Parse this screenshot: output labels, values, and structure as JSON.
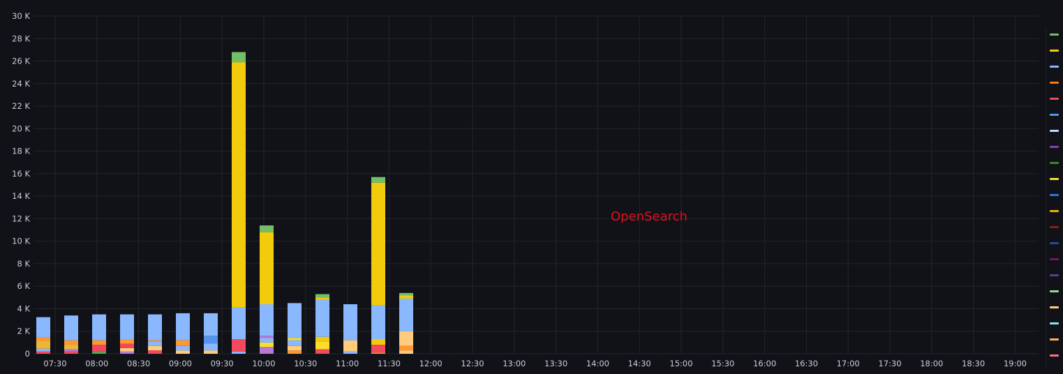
{
  "watermark": "OpenSearch",
  "chart_data": {
    "type": "bar",
    "stacked": true,
    "ylim": [
      0,
      30000
    ],
    "yticks": [
      0,
      2000,
      4000,
      6000,
      8000,
      10000,
      12000,
      14000,
      16000,
      18000,
      20000,
      22000,
      24000,
      26000,
      28000,
      30000
    ],
    "ytick_labels": [
      "0",
      "2 K",
      "4 K",
      "6 K",
      "8 K",
      "10 K",
      "12 K",
      "14 K",
      "16 K",
      "18 K",
      "20 K",
      "22 K",
      "24 K",
      "26 K",
      "28 K",
      "30 K"
    ],
    "xtick_labels": [
      "07:30",
      "08:00",
      "08:30",
      "09:00",
      "09:30",
      "10:00",
      "10:30",
      "11:00",
      "11:30",
      "12:00",
      "12:30",
      "13:00",
      "13:30",
      "14:00",
      "14:30",
      "15:00",
      "15:30",
      "16:00",
      "16:30",
      "17:00",
      "17:30",
      "18:00",
      "18:30",
      "19:00"
    ],
    "categories": [
      "07:20",
      "07:35",
      "07:50",
      "08:05",
      "08:20",
      "08:35",
      "08:50",
      "09:05",
      "09:20",
      "09:35",
      "09:50",
      "10:05",
      "10:20",
      "10:35",
      "10:50",
      "11:05",
      "11:20",
      "11:35",
      "11:50",
      "12:05",
      "12:20",
      "12:35",
      "12:50",
      "13:05"
    ],
    "segment_colors": [
      "#f2495c",
      "#b877d9",
      "#ff9830",
      "#5794f2",
      "#fade2a",
      "#ffcb7d",
      "#8ab8ff",
      "#eab839",
      "#f2cc0c",
      "#56a64b",
      "#73bf69"
    ],
    "segments": [
      [
        [
          0,
          200
        ],
        [
          6,
          250
        ],
        [
          7,
          700
        ],
        [
          2,
          300
        ],
        [
          6,
          1800
        ]
      ],
      [
        [
          0,
          200
        ],
        [
          1,
          200
        ],
        [
          7,
          400
        ],
        [
          2,
          400
        ],
        [
          6,
          2200
        ]
      ],
      [
        [
          9,
          200
        ],
        [
          0,
          600
        ],
        [
          2,
          400
        ],
        [
          6,
          2300
        ]
      ],
      [
        [
          1,
          200
        ],
        [
          5,
          300
        ],
        [
          0,
          400
        ],
        [
          2,
          400
        ],
        [
          6,
          2200
        ]
      ],
      [
        [
          0,
          300
        ],
        [
          5,
          400
        ],
        [
          6,
          400
        ],
        [
          2,
          100
        ],
        [
          6,
          2300
        ]
      ],
      [
        [
          5,
          300
        ],
        [
          6,
          400
        ],
        [
          2,
          500
        ],
        [
          6,
          2400
        ]
      ],
      [
        [
          5,
          300
        ],
        [
          6,
          600
        ],
        [
          3,
          700
        ],
        [
          6,
          2000
        ]
      ],
      [
        [
          6,
          200
        ],
        [
          0,
          1100
        ],
        [
          6,
          2800
        ],
        [
          8,
          21800
        ],
        [
          10,
          900
        ]
      ],
      [
        [
          1,
          600
        ],
        [
          4,
          400
        ],
        [
          6,
          400
        ],
        [
          1,
          200
        ],
        [
          6,
          2800
        ],
        [
          8,
          6400
        ],
        [
          10,
          600
        ]
      ],
      [
        [
          2,
          300
        ],
        [
          5,
          400
        ],
        [
          6,
          500
        ],
        [
          4,
          200
        ],
        [
          6,
          3100
        ]
      ],
      [
        [
          0,
          400
        ],
        [
          4,
          700
        ],
        [
          8,
          400
        ],
        [
          6,
          3300
        ],
        [
          8,
          200
        ],
        [
          10,
          300
        ]
      ],
      [
        [
          6,
          200
        ],
        [
          5,
          1000
        ],
        [
          6,
          3200
        ]
      ],
      [
        [
          2,
          100
        ],
        [
          0,
          700
        ],
        [
          8,
          500
        ],
        [
          6,
          3000
        ],
        [
          8,
          10900
        ],
        [
          10,
          500
        ]
      ],
      [
        [
          5,
          300
        ],
        [
          2,
          400
        ],
        [
          5,
          1300
        ],
        [
          6,
          2900
        ],
        [
          8,
          300
        ],
        [
          10,
          200
        ]
      ],
      [],
      [],
      [],
      [],
      [],
      [],
      [],
      [],
      [],
      []
    ],
    "legend_colors": [
      "#73bf69",
      "#f2cc0c",
      "#8ab8ff",
      "#ff780a",
      "#f2495c",
      "#5794f2",
      "#c0d8ff",
      "#8f3bb8",
      "#37872d",
      "#fade2a",
      "#3274d9",
      "#e0b400",
      "#8e1d17",
      "#1f4e94",
      "#6e1a5f",
      "#5b3e8f",
      "#96d98d",
      "#ffcb7d",
      "#8ae0f0",
      "#ffb357",
      "#ff7383"
    ]
  }
}
